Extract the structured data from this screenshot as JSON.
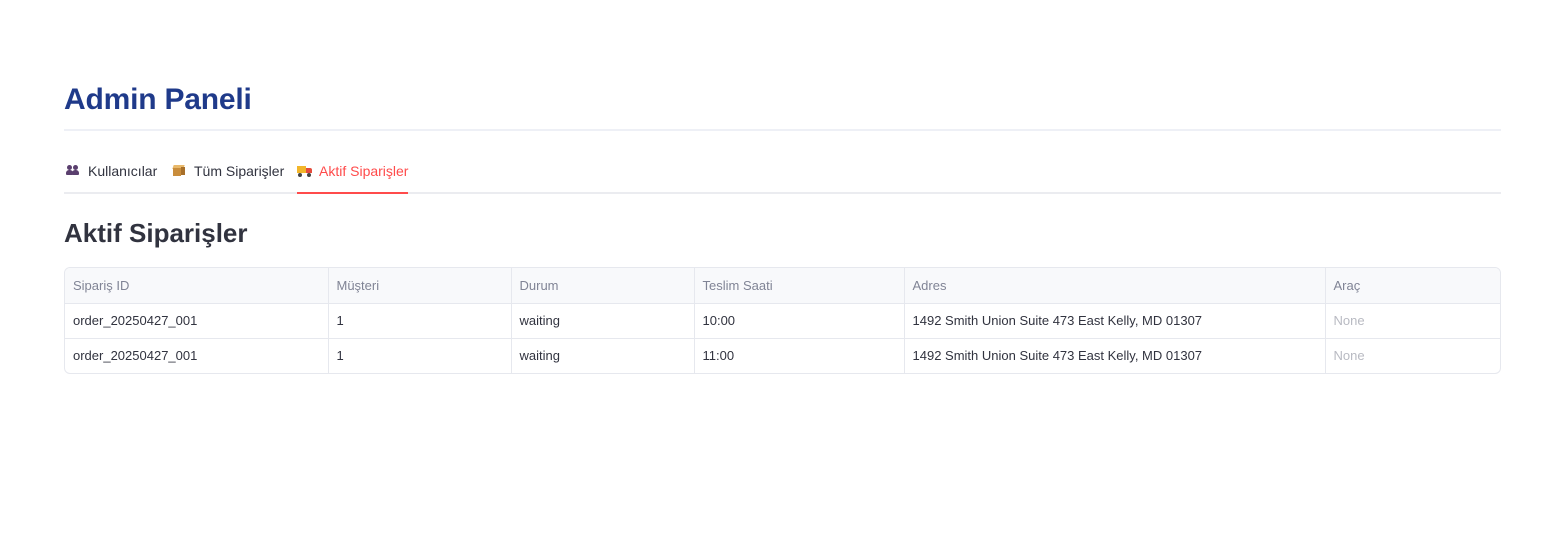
{
  "header": {
    "title": "Admin Paneli"
  },
  "tabs": [
    {
      "label": "Kullanıcılar",
      "icon": "users-icon",
      "active": false
    },
    {
      "label": "Tüm Siparişler",
      "icon": "package-icon",
      "active": false
    },
    {
      "label": "Aktif Siparişler",
      "icon": "truck-icon",
      "active": true
    }
  ],
  "section": {
    "title": "Aktif Siparişler"
  },
  "table": {
    "columns": [
      "Sipariş ID",
      "Müşteri",
      "Durum",
      "Teslim Saati",
      "Adres",
      "Araç"
    ],
    "rows": [
      [
        "order_20250427_001",
        "1",
        "waiting",
        "10:00",
        "1492 Smith Union Suite 473 East Kelly, MD 01307",
        "None"
      ],
      [
        "order_20250427_001",
        "1",
        "waiting",
        "11:00",
        "1492 Smith Union Suite 473 East Kelly, MD 01307",
        "None"
      ]
    ]
  },
  "colors": {
    "title": "#1f3a8a",
    "active_tab": "#ff4b4b",
    "text": "#31333f",
    "muted": "#808495"
  }
}
